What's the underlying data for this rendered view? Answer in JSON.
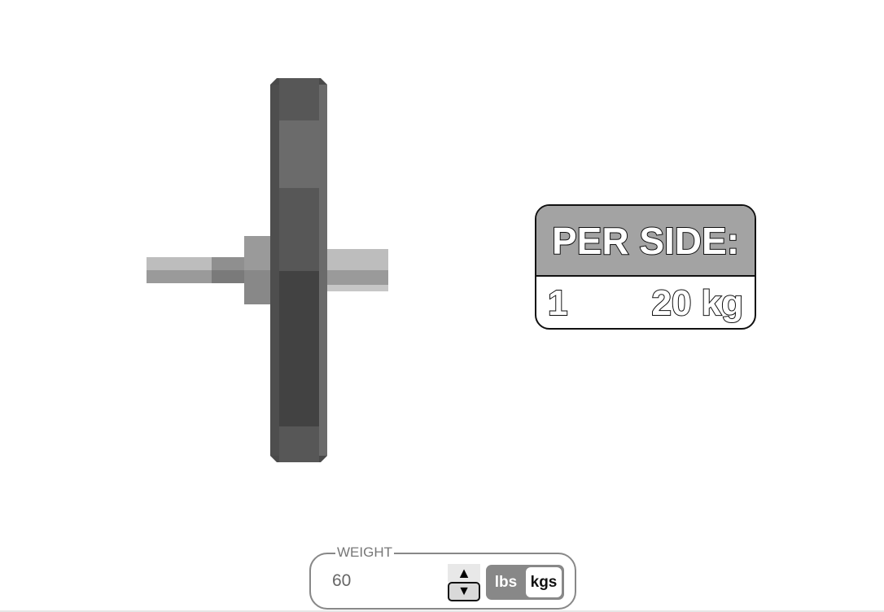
{
  "per_side": {
    "title": "PER SIDE:",
    "plates": [
      {
        "count": "1",
        "weight": "20 kg"
      }
    ]
  },
  "weight_control": {
    "legend": "WEIGHT",
    "value": "60",
    "spin_up_icon": "triangle-up-icon",
    "spin_down_icon": "triangle-down-icon",
    "units": [
      {
        "label": "lbs",
        "selected": false
      },
      {
        "label": "kgs",
        "selected": true
      }
    ]
  },
  "colors": {
    "plate_dark": "#424242",
    "plate_mid": "#575757",
    "plate_light": "#6b6b6b",
    "bar_light": "#bdbdbd",
    "bar_mid": "#999999",
    "header_gray": "#a3a3a3",
    "toggle_gray": "#888888"
  }
}
